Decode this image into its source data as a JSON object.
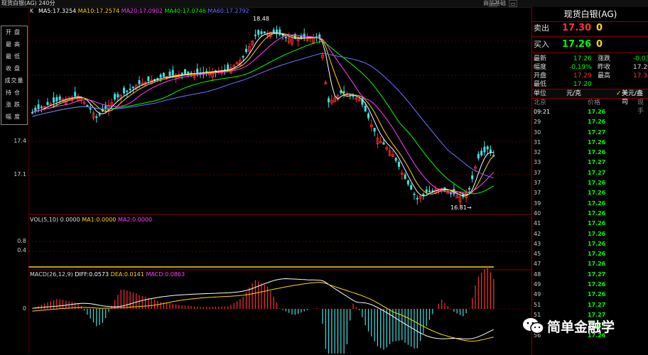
{
  "window": {
    "title": "现货白银(AG) 240分",
    "menu": "商品基础"
  },
  "kline": {
    "mode": "K",
    "ma_labels": [
      {
        "text": "MA5:17.3254",
        "color": "#ffffff"
      },
      {
        "text": "MA10:17.2574",
        "color": "#ffd700"
      },
      {
        "text": "MA20:17.0902",
        "color": "#ff40ff"
      },
      {
        "text": "MA40:17.0746",
        "color": "#00ff00"
      },
      {
        "text": "MA60:17.2792",
        "color": "#7070ff"
      }
    ],
    "y_ticks": [
      "17.4",
      "17.1"
    ],
    "high_label": "18.48",
    "low_label": "16.81→"
  },
  "vol": {
    "label": "VOL(5,10) 0.0000",
    "ma1": "MA1:0.0000",
    "ma2": "MA2:0.0000",
    "y_ticks": [
      "0.8",
      "0.4"
    ]
  },
  "macd": {
    "label": "MACD(26,12,9)",
    "diff": "DIFF:0.0573",
    "dea": "DEA:0.0141",
    "macd": "MACD:0.0863",
    "zero": "0"
  },
  "menu_items": [
    "开盘",
    "最高",
    "最低",
    "收盘",
    "成交量",
    "持仓",
    "涨跌",
    "幅度"
  ],
  "quote": {
    "title": "现货白银(AG)",
    "sell_label": "卖出",
    "sell_price": "17.30",
    "sell_vol": "0",
    "buy_label": "买入",
    "buy_price": "17.26",
    "buy_vol": "0",
    "latest_label": "最新",
    "latest": "17.26",
    "change_label": "涨跌",
    "change": "-0.03",
    "pct_label": "幅度",
    "pct": "-0.19%",
    "prev_label": "昨收",
    "prev": "17.29",
    "open_label": "开盘",
    "open": "17.29",
    "high_label": "最高",
    "high": "17.34",
    "low_label": "最低",
    "low": "17.20",
    "unit_label": "单位",
    "unit": "元/克",
    "unit2": "美元/盎司",
    "col_loc": "北京",
    "col_price": "价格",
    "col_vol": "现手"
  },
  "ticks": [
    {
      "t": "09:21",
      "p": "17.26"
    },
    {
      "t": "29",
      "p": "17.26"
    },
    {
      "t": "30",
      "p": "17.27"
    },
    {
      "t": "31",
      "p": "17.26"
    },
    {
      "t": "32",
      "p": "17.26"
    },
    {
      "t": "33",
      "p": "17.27"
    },
    {
      "t": "37",
      "p": "17.27"
    },
    {
      "t": "37",
      "p": "17.26"
    },
    {
      "t": "37",
      "p": "17.26"
    },
    {
      "t": "39",
      "p": "17.26"
    },
    {
      "t": "40",
      "p": "17.26"
    },
    {
      "t": "41",
      "p": "17.26"
    },
    {
      "t": "42",
      "p": "17.26"
    },
    {
      "t": "43",
      "p": "17.26"
    },
    {
      "t": "45",
      "p": "17.26"
    },
    {
      "t": "47",
      "p": "17.26"
    },
    {
      "t": "48",
      "p": "17.27"
    },
    {
      "t": "49",
      "p": "17.26"
    },
    {
      "t": "49",
      "p": "17.26"
    },
    {
      "t": "51",
      "p": "17.27"
    },
    {
      "t": "51",
      "p": "17.27"
    },
    {
      "t": "56",
      "p": "17.27"
    },
    {
      "t": "56",
      "p": "17.26"
    }
  ],
  "watermark": "简单金融学",
  "colors": {
    "up": "#ff3030",
    "down": "#40e0e0",
    "grid": "#8a0000",
    "label": "#ffd700"
  }
}
